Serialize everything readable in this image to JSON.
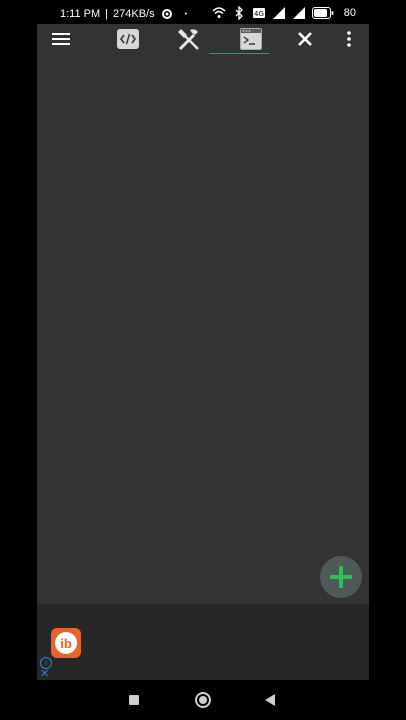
{
  "status_bar": {
    "time": "1:11 PM",
    "separator": "|",
    "net_speed": "274KB/s",
    "dot": "•",
    "battery_percent": "80",
    "icons": [
      "settings-gear-icon",
      "wifi-icon",
      "bluetooth-icon",
      "volte-icon",
      "signal-icon",
      "signal-2-icon",
      "battery-icon"
    ]
  },
  "toolbar": {
    "icons": [
      "menu-icon",
      "code-icon",
      "tools-icon",
      "console-icon",
      "close-icon",
      "more-vert-icon"
    ],
    "active_tab": "console"
  },
  "fab": {
    "icon": "plus-icon",
    "color": "#2fbf58"
  },
  "ad": {
    "logo_text": "ib",
    "logo_color": "#e8642b",
    "info_text": "i",
    "close_text": "✕"
  },
  "nav_bar": {
    "icons": [
      "recents-icon",
      "home-icon",
      "back-icon"
    ]
  }
}
